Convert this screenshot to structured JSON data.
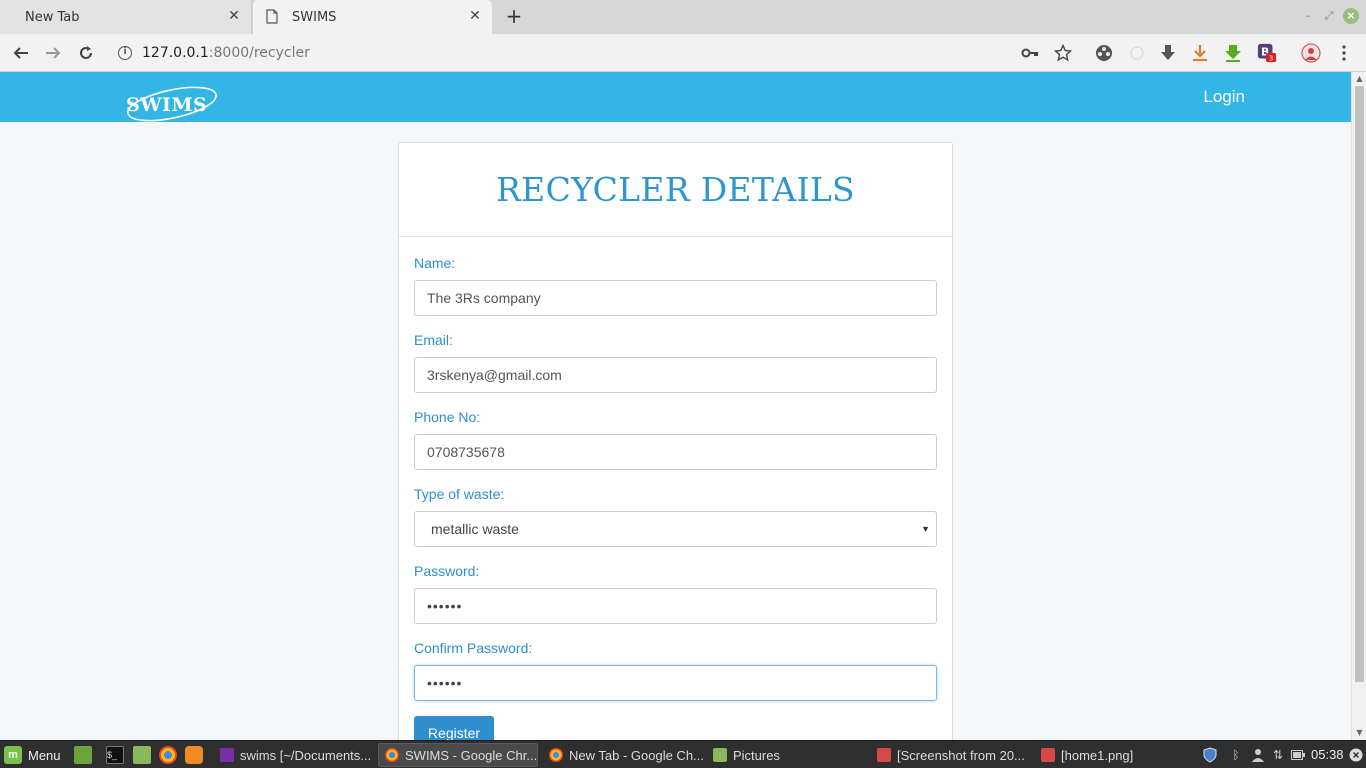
{
  "browser": {
    "tabs": [
      {
        "title": "New Tab",
        "active": false
      },
      {
        "title": "SWIMS",
        "active": true
      }
    ],
    "url_host": "127.0.0.1",
    "url_path": ":8000/recycler",
    "extension_badge": "3"
  },
  "site": {
    "logo": "SWIMS",
    "nav_login": "Login"
  },
  "form": {
    "title": "RECYCLER DETAILS",
    "fields": [
      {
        "label": "Name:",
        "value": "The 3Rs company"
      },
      {
        "label": "Email:",
        "value": "3rskenya@gmail.com"
      },
      {
        "label": "Phone No:",
        "value": "0708735678"
      },
      {
        "label": "Type of waste:",
        "value": "metallic waste"
      },
      {
        "label": "Password:",
        "value": "••••••"
      },
      {
        "label": "Confirm Password:",
        "value": "••••••"
      }
    ],
    "submit_label": "Register"
  },
  "taskbar": {
    "menu_label": "Menu",
    "tasks": [
      {
        "title": "swims [~/Documents...",
        "active": false
      },
      {
        "title": "SWIMS - Google Chr...",
        "active": true
      },
      {
        "title": "New Tab - Google Ch...",
        "active": false
      },
      {
        "title": "Pictures",
        "active": false
      },
      {
        "title": "[Screenshot from 20...",
        "active": false
      },
      {
        "title": "[home1.png]",
        "active": false
      }
    ],
    "clock": "05:38"
  },
  "colors": {
    "navbar": "#33b5e5",
    "accent": "#2e8fcc",
    "title": "#2e95cf"
  }
}
